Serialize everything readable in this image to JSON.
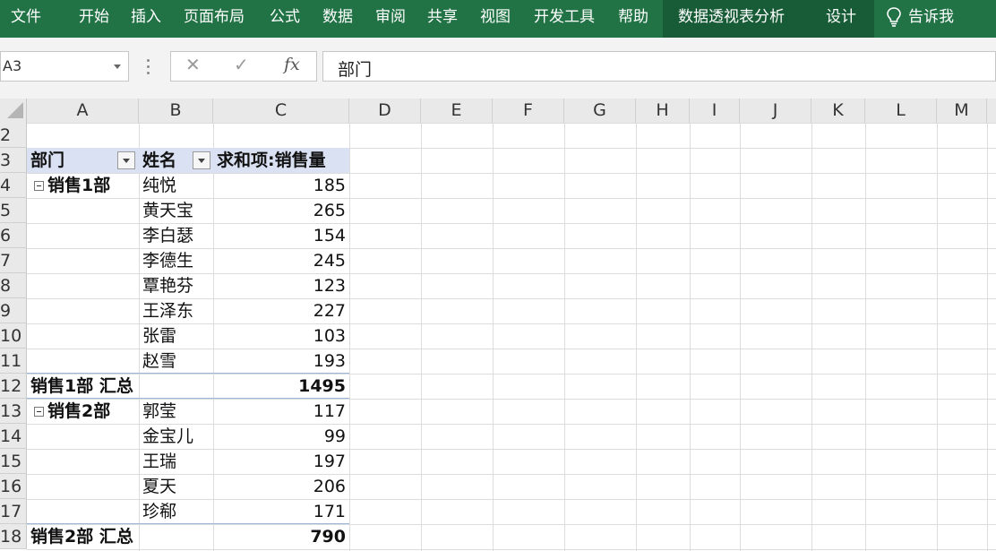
{
  "ribbon": {
    "tabs": [
      "文件",
      "开始",
      "插入",
      "页面布局",
      "公式",
      "数据",
      "审阅",
      "共享",
      "视图",
      "开发工具",
      "帮助"
    ],
    "context_tabs": [
      "数据透视表分析",
      "设计"
    ],
    "tell_me": "告诉我",
    "colors": {
      "ribbon": "#217346",
      "context": "#185c37"
    }
  },
  "formula_bar": {
    "name_box": "A3",
    "fx_label": "fx",
    "cancel_icon": "close-icon",
    "enter_icon": "check-icon",
    "content": "部门"
  },
  "columns": [
    "A",
    "B",
    "C",
    "D",
    "E",
    "F",
    "G",
    "H",
    "I",
    "J",
    "K",
    "L",
    "M"
  ],
  "rows": [
    "2",
    "3",
    "4",
    "5",
    "6",
    "7",
    "8",
    "9",
    "10",
    "11",
    "12",
    "13",
    "14",
    "15",
    "16",
    "17",
    "18"
  ],
  "pivot": {
    "header": {
      "dept": "部门",
      "name": "姓名",
      "value": "求和项:销售量"
    },
    "groups": [
      {
        "dept": "销售1部",
        "items": [
          {
            "name": "纯悦",
            "value": "185"
          },
          {
            "name": "黄天宝",
            "value": "265"
          },
          {
            "name": "李白瑟",
            "value": "154"
          },
          {
            "name": "李德生",
            "value": "245"
          },
          {
            "name": "覃艳芬",
            "value": "123"
          },
          {
            "name": "王泽东",
            "value": "227"
          },
          {
            "name": "张雷",
            "value": "103"
          },
          {
            "name": "赵雪",
            "value": "193"
          }
        ],
        "subtotal_label": "销售1部 汇总",
        "subtotal": "1495"
      },
      {
        "dept": "销售2部",
        "items": [
          {
            "name": "郭莹",
            "value": "117"
          },
          {
            "name": "金宝儿",
            "value": "99"
          },
          {
            "name": "王瑞",
            "value": "197"
          },
          {
            "name": "夏天",
            "value": "206"
          },
          {
            "name": "珍郗",
            "value": "171"
          }
        ],
        "subtotal_label": "销售2部 汇总",
        "subtotal": "790"
      }
    ]
  }
}
